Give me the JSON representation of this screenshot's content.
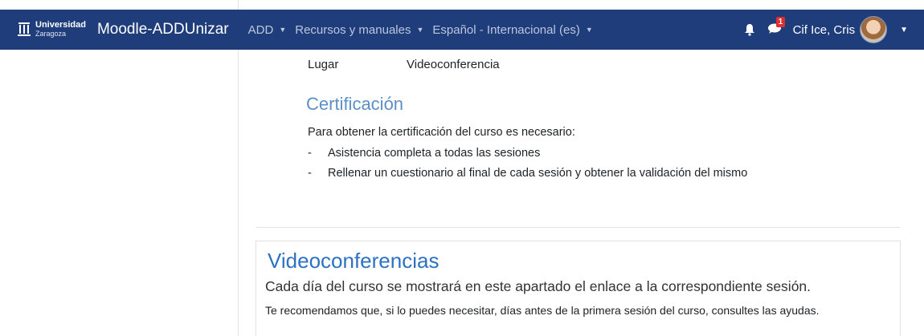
{
  "navbar": {
    "logo_line1": "Universidad",
    "logo_line2": "Zaragoza",
    "site_name": "Moodle-ADDUnizar",
    "menu": [
      {
        "label": "ADD"
      },
      {
        "label": "Recursos y manuales"
      },
      {
        "label": "Español - Internacional (es)"
      }
    ],
    "message_count": "1",
    "user_name": "Cif Ice, Cris",
    "colors": {
      "background": "#1f3d7b",
      "badge": "#e02d2d"
    }
  },
  "content": {
    "lugar_label": "Lugar",
    "lugar_value": "Videoconferencia",
    "cert_title": "Certificación",
    "cert_intro": "Para obtener la certificación del curso es necesario:",
    "cert_items": [
      "Asistencia completa a todas las sesiones",
      "Rellenar un cuestionario al final de cada sesión y obtener la validación del mismo"
    ],
    "dash": "-"
  },
  "card": {
    "title": "Videoconferencias",
    "text1": "Cada día del curso se mostrará en este apartado el enlace a la correspondiente sesión.",
    "text2": "Te recomendamos que, si lo puedes necesitar, días antes de la primera sesión del curso, consultes las ayudas."
  },
  "icons": [
    "university-logo-icon",
    "caret-down-icon",
    "bell-icon",
    "message-icon",
    "avatar"
  ]
}
